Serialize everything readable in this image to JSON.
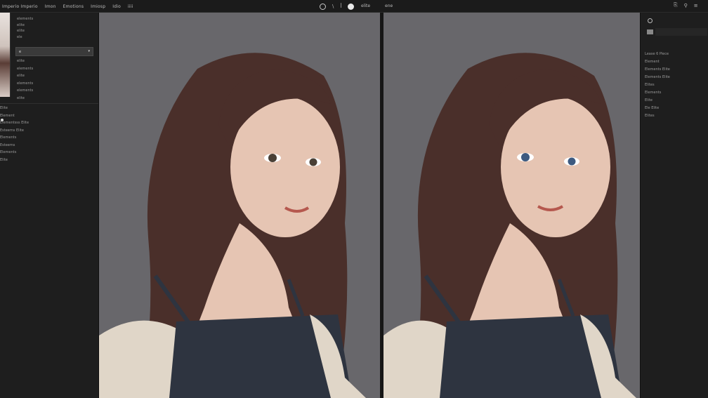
{
  "menu": {
    "items": [
      "Imperio Imperio",
      "Imon",
      "Emotions",
      "Imiosp",
      "Idio",
      "iiii"
    ]
  },
  "toolbar_a": {
    "tools": [
      "circle-icon",
      "slash-icon",
      "pen-icon",
      "moon-icon"
    ],
    "label": "elite"
  },
  "tab_b": {
    "title": "ene"
  },
  "toolbar_b": {
    "tools": [
      "export-icon",
      "pin-icon",
      "settings-icon"
    ]
  },
  "left_panel": {
    "props_top": [
      "elements",
      "elite",
      "elite",
      "ele"
    ],
    "dropdown_value": "e",
    "props_bottom": [
      "elite",
      "elements",
      "elite",
      "elements",
      "elements",
      "elite"
    ],
    "layers": [
      "Elite",
      "Element",
      "Elementsss Elite",
      "Esteems Elite",
      "Elements",
      "Esteems",
      "Elements",
      "Elite"
    ]
  },
  "right_panel": {
    "items": [
      "Lease 6 Piece",
      "Element",
      "Elements Elite",
      "Elements Elite",
      "Elites",
      "Elements",
      "Elite",
      "Ele Elite",
      "Elites"
    ]
  },
  "canvas": {
    "before_label": "before-image",
    "after_label": "after-image"
  },
  "colors": {
    "background": "#68676b",
    "hair": "#4a2f2a",
    "skin": "#e6c5b3",
    "top": "#2e3440",
    "sweater": "#e0d6c8",
    "eyes_before": "#4a4036",
    "eyes_after": "#3d5a80"
  }
}
